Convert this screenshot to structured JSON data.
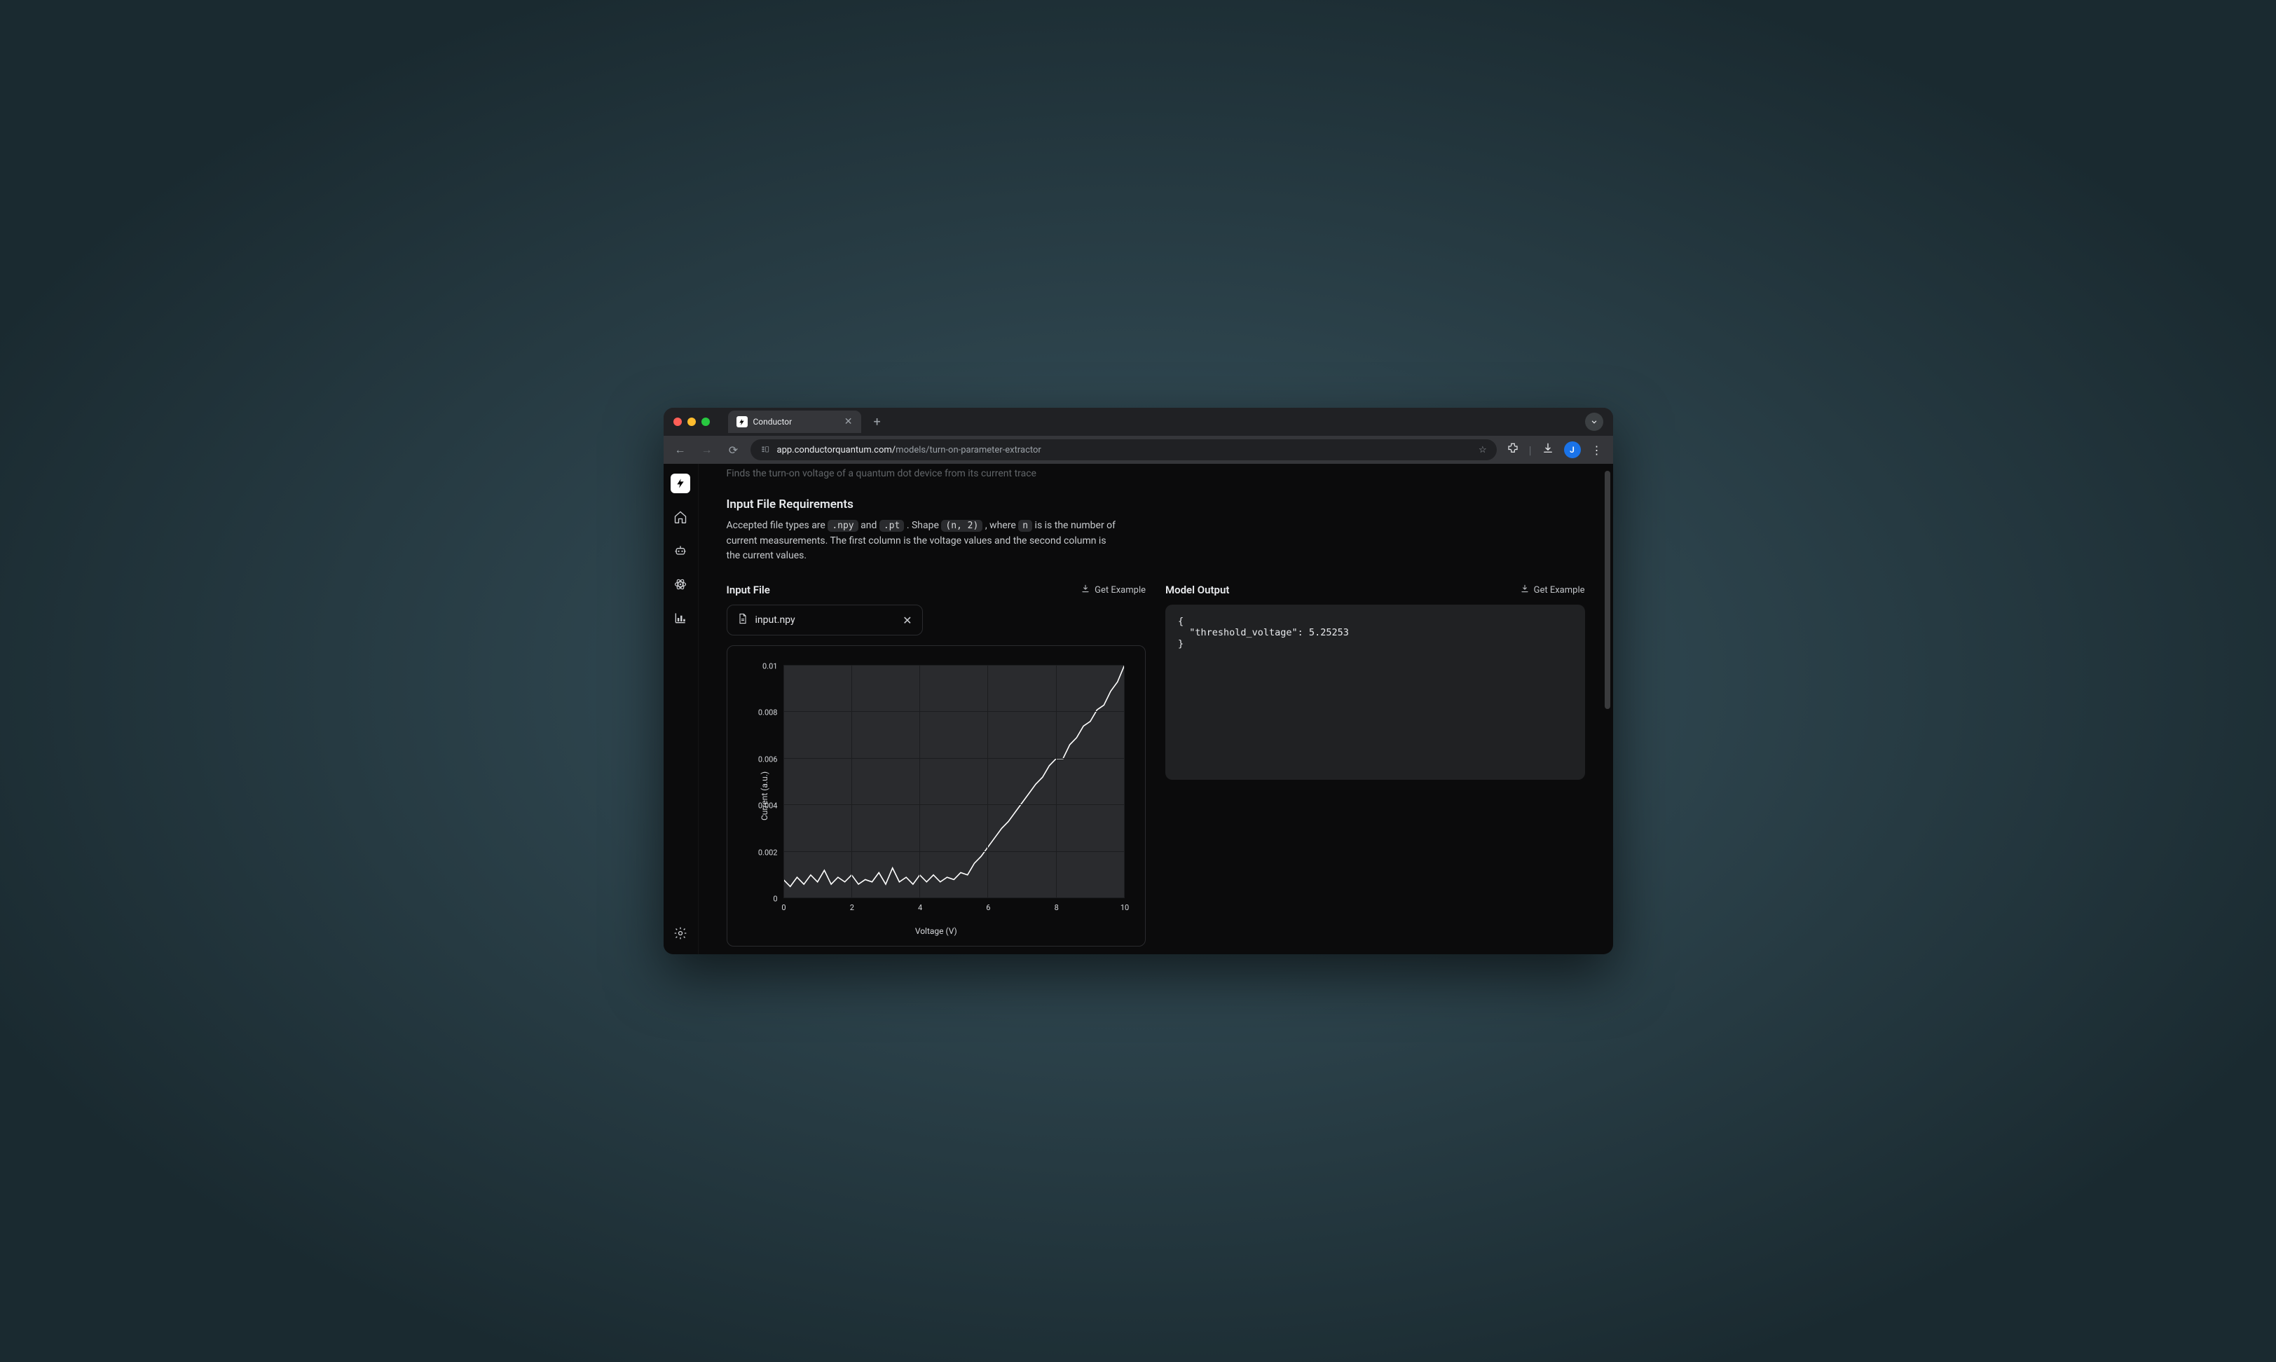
{
  "browser": {
    "tab_title": "Conductor",
    "url_host": "app.conductorquantum.com/",
    "url_path": "models/turn-on-parameter-extractor",
    "avatar_initial": "J"
  },
  "page": {
    "truncated_prev_line": "Finds the turn-on voltage of a quantum dot device from its current trace",
    "requirements_title": "Input File Requirements",
    "desc_full": "Accepted file types are .npy and .pt. Shape (n, 2), where n is is the number of current measurements. The first column is the voltage values and the second column is the current values.",
    "desc_parts": {
      "p1": "Accepted file types are ",
      "npy": ".npy",
      "p2": " and ",
      "pt": ".pt",
      "p3": " . Shape ",
      "shape": "(n, 2)",
      "p4": " , where ",
      "n": "n",
      "p5": " is is the number of current measurements. The first column is the voltage values and the second column is the current values."
    },
    "input_file_label": "Input File",
    "model_output_label": "Model Output",
    "get_example": "Get Example",
    "file_name": "input.npy",
    "output_json": "{\n  \"threshold_voltage\": 5.25253\n}"
  },
  "chart_data": {
    "type": "line",
    "title": "",
    "xlabel": "Voltage (V)",
    "ylabel": "Current (a.u.)",
    "xlim": [
      0,
      10
    ],
    "ylim": [
      0,
      0.01
    ],
    "x_ticks": [
      0,
      2,
      4,
      6,
      8,
      10
    ],
    "y_ticks": [
      0,
      0.002,
      0.004,
      0.006,
      0.008,
      0.01
    ],
    "x": [
      0,
      0.2,
      0.4,
      0.6,
      0.8,
      1,
      1.2,
      1.4,
      1.6,
      1.8,
      2,
      2.2,
      2.4,
      2.6,
      2.8,
      3,
      3.2,
      3.4,
      3.6,
      3.8,
      4,
      4.2,
      4.4,
      4.6,
      4.8,
      5,
      5.2,
      5.4,
      5.6,
      5.8,
      6,
      6.2,
      6.4,
      6.6,
      6.8,
      7,
      7.2,
      7.4,
      7.6,
      7.8,
      8,
      8.2,
      8.4,
      8.6,
      8.8,
      9,
      9.2,
      9.4,
      9.6,
      9.8,
      10
    ],
    "y": [
      0.0008,
      0.0005,
      0.0009,
      0.0006,
      0.001,
      0.0007,
      0.0012,
      0.0006,
      0.0009,
      0.0007,
      0.001,
      0.0006,
      0.0008,
      0.0007,
      0.0011,
      0.0006,
      0.0013,
      0.0007,
      0.0009,
      0.0006,
      0.001,
      0.0007,
      0.001,
      0.0007,
      0.0009,
      0.0008,
      0.0011,
      0.001,
      0.0015,
      0.0018,
      0.0022,
      0.0026,
      0.003,
      0.0033,
      0.0037,
      0.0041,
      0.0045,
      0.0049,
      0.0052,
      0.0057,
      0.006,
      0.006,
      0.0066,
      0.0069,
      0.0074,
      0.0076,
      0.0081,
      0.0083,
      0.0089,
      0.0093,
      0.01
    ]
  }
}
